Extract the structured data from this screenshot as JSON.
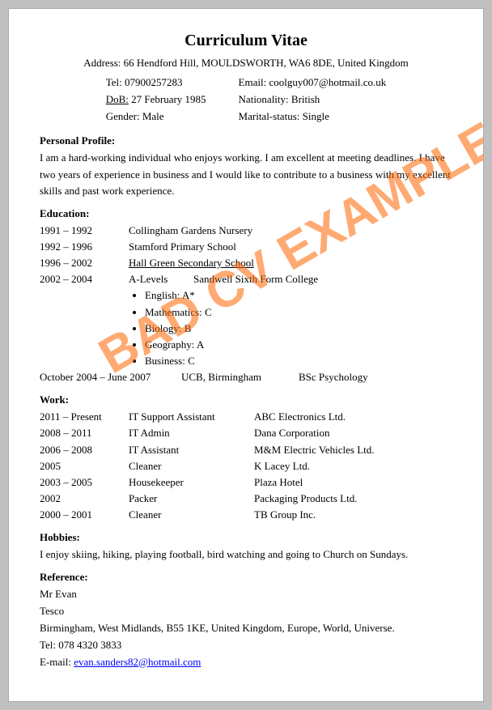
{
  "title": "Curriculum Vitae",
  "address": "Address: 66 Hendford Hill, MOULDSWORTH, WA6 8DE, United Kingdom",
  "contact": {
    "tel_label": "Tel:",
    "tel": "07900257283",
    "dob_label": "DoB:",
    "dob": "27 February 1985",
    "gender_label": "Gender:",
    "gender": "Male",
    "email_label": "Email:",
    "email": "coolguy007@hotmail.co.uk",
    "nationality_label": "Nationality:",
    "nationality": "British",
    "marital_label": "Marital-status:",
    "marital": "Single"
  },
  "personal_profile": {
    "title": "Personal Profile:",
    "text": "I am a hard-working individual who enjoys working. I am excellent at meeting deadlines. I have two years of experience in business and I would like to contribute to a business with my excellent skills and past work experience."
  },
  "education": {
    "title": "Education:",
    "rows": [
      {
        "years": "1991 – 1992",
        "place": "Collingham Gardens Nursery",
        "role": "",
        "extra": ""
      },
      {
        "years": "1992 – 1996",
        "place": "Stamford Primary School",
        "role": "",
        "extra": ""
      },
      {
        "years": "1996 – 2002",
        "place": "Hall Green Secondary School",
        "role": "",
        "extra": ""
      }
    ],
    "alevels": {
      "years": "2002 – 2004",
      "label": "A-Levels",
      "school": "Sandwell Sixth Form College"
    },
    "subjects": [
      "English: A*",
      "Mathematics: C",
      "Biology: B",
      "Geography: A",
      "Business: C"
    ],
    "university": {
      "years": "October 2004 – June 2007",
      "place": "UCB, Birmingham",
      "degree": "BSc Psychology"
    }
  },
  "work": {
    "title": "Work:",
    "rows": [
      {
        "years": "2011 – Present",
        "role": "IT Support Assistant",
        "company": "ABC Electronics Ltd."
      },
      {
        "years": "2008 – 2011",
        "role": "IT Admin",
        "company": "Dana Corporation"
      },
      {
        "years": "2006 – 2008",
        "role": "IT Assistant",
        "company": "M&M Electric Vehicles Ltd."
      },
      {
        "years": "2005",
        "role": "Cleaner",
        "company": "K Lacey Ltd."
      },
      {
        "years": "2003 – 2005",
        "role": "Housekeeper",
        "company": "Plaza Hotel"
      },
      {
        "years": "2002",
        "role": "Packer",
        "company": "Packaging Products Ltd."
      },
      {
        "years": "2000 – 2001",
        "role": "Cleaner",
        "company": "TB Group Inc."
      }
    ]
  },
  "hobbies": {
    "title": "Hobbies:",
    "text": "I enjoy skiing, hiking, playing football, bird watching and going to Church on Sundays."
  },
  "reference": {
    "title": "Reference:",
    "name": "Mr Evan",
    "company": "Tesco",
    "address": "Birmingham, West Midlands, B55 1KE, United Kingdom, Europe, World, Universe.",
    "tel_label": "Tel:",
    "tel": "078 4320 3833",
    "email_label": "E-mail:",
    "email_link": "evan.sanders82@hotmail.com"
  },
  "watermark": "BAD CV EXAMPLE"
}
